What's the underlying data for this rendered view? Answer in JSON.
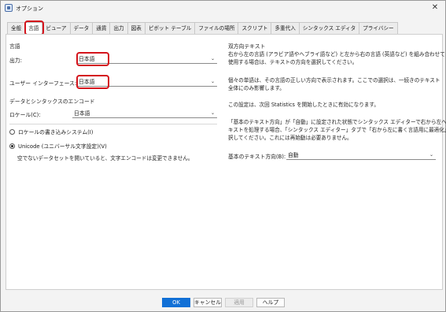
{
  "window": {
    "title": "オプション",
    "close_glyph": "✕"
  },
  "tabs": [
    {
      "label": "全般"
    },
    {
      "label": "言語"
    },
    {
      "label": "ビューア"
    },
    {
      "label": "データ"
    },
    {
      "label": "通貨"
    },
    {
      "label": "出力"
    },
    {
      "label": "図表"
    },
    {
      "label": "ピボット テーブル"
    },
    {
      "label": "ファイルの場所"
    },
    {
      "label": "スクリプト"
    },
    {
      "label": "多重代入"
    },
    {
      "label": "シンタックス エディタ"
    },
    {
      "label": "プライバシー"
    }
  ],
  "active_tab": "言語",
  "language": {
    "heading": "言語",
    "output_label": "出力:",
    "output_value": "日本語",
    "ui_label": "ユーザー インターフェース:",
    "ui_value": "日本語"
  },
  "encoding": {
    "heading": "データとシンタックスのエンコード",
    "locale_label": "ロケール(C):",
    "locale_value": "日本語",
    "radio_locale": "ロケールの書き込みシステム(I)",
    "radio_unicode": "Unicode (ユニバーサル文字設定)(V)",
    "selected": "unicode",
    "note": "空でないデータセットを開いていると、文字エンコードは変更できません。"
  },
  "bidi": {
    "heading": "双方向テキスト",
    "para1_line1": "右から左の言語 (アラビア語やヘブライ語など) と左から右の言語 (英語など) を組み合わせて",
    "para1_line2": "使用する場合は、テキストの方向を選択してください。",
    "para2_line1": "個々の単語は、その言語の正しい方向で表示されます。ここでの選択は、一続きのテキスト",
    "para2_line2": "全体にのみ影響します。",
    "para3": "この設定は、次回 Statistics を開始したときに有効になります。",
    "para4_line1": "「基本のテキスト方向」が「自動」に設定された状態でシンタックス エディターで右から左へのテ",
    "para4_line2": "キストを処理する場合、「シンタックス エディター」タブで「右から左に書く言語用に最適化」も選",
    "para4_line3": "択してください。これには再始動は必要ありません。",
    "base_dir_label": "基本のテキスト方向(B):",
    "base_dir_value": "自動"
  },
  "buttons": {
    "ok": "OK",
    "cancel": "キャンセル",
    "apply": "適用",
    "help": "ヘルプ"
  },
  "colors": {
    "accent": "#1170d6",
    "highlight": "#d4141c"
  }
}
